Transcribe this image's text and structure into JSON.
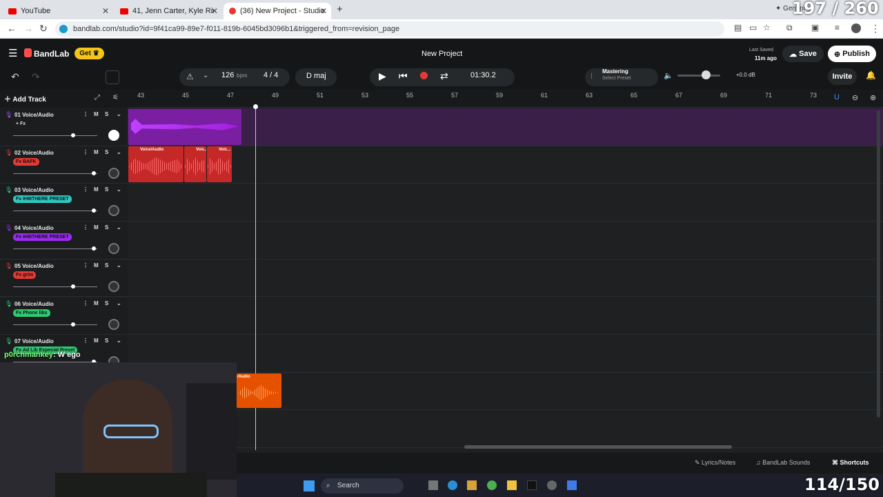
{
  "browser": {
    "tabs": [
      {
        "label": "YouTube"
      },
      {
        "label": "41, Jenn Carter, Kyle Richh, Tata"
      },
      {
        "label": "(36) New Project - Studio"
      }
    ],
    "new_tab": "+",
    "url": "bandlab.com/studio?id=9f41ca99-89e7-f011-819b-6045bd3096b1&triggered_from=revision_page",
    "right_badge": "Gemini"
  },
  "app": {
    "brand": "BandLab",
    "get_label": "Get",
    "project_title": "New Project",
    "last_saved_label": "Last Saved",
    "last_saved_time": "11m ago",
    "save_label": "Save",
    "publish_label": "Publish"
  },
  "toolbar": {
    "bpm_value": "126",
    "bpm_unit": "bpm",
    "time_sig": "4 / 4",
    "key": "D maj",
    "time": "01:30.2",
    "mastering_label": "Mastering",
    "mastering_preset": "Select Preset",
    "volume_db": "+0.0 dB",
    "invite_label": "Invite"
  },
  "tracks_header": {
    "add_track_label": "Add Track"
  },
  "ruler": [
    "43",
    "45",
    "47",
    "49",
    "51",
    "53",
    "55",
    "57",
    "59",
    "61",
    "63",
    "65",
    "67",
    "69",
    "71",
    "73"
  ],
  "tracks": [
    {
      "name": "01  Voice/Audio",
      "fx": "+ Fx",
      "fx_color": "none",
      "mic_color": "#b04cff",
      "m": "M",
      "s": "S",
      "volume": 0.7
    },
    {
      "name": "02  Voice/Audio",
      "fx": "Fx BAFK",
      "fx_color": "#e53935",
      "mic_color": "#e53935",
      "m": "M",
      "s": "S",
      "volume": 0.95
    },
    {
      "name": "03  Voice/Audio",
      "fx": "Fx IH8ITHERE PRESET",
      "fx_color": "#2ec9c2",
      "mic_color": "#2ec98a",
      "m": "M",
      "s": "S",
      "volume": 0.95
    },
    {
      "name": "04  Voice/Audio",
      "fx": "Fx IH8ITHERE PRESET",
      "fx_color": "#9b2cf0",
      "mic_color": "#9b2cf0",
      "m": "M",
      "s": "S",
      "volume": 0.95
    },
    {
      "name": "05  Voice/Audio",
      "fx": "Fx grim",
      "fx_color": "#e53935",
      "mic_color": "#e53935",
      "m": "M",
      "s": "S",
      "volume": 0.7
    },
    {
      "name": "06  Voice/Audio",
      "fx": "Fx Phone libs",
      "fx_color": "#2ecc71",
      "mic_color": "#2ecc71",
      "m": "M",
      "s": "S",
      "volume": 0.7
    },
    {
      "name": "07  Voice/Audio",
      "fx": "Fx Ad Lib Especial Preset",
      "fx_color": "#2ecc71",
      "mic_color": "#2ecc71",
      "m": "M",
      "s": "S",
      "volume": 0.95
    }
  ],
  "clips": {
    "track2": [
      "Voice/Audio",
      "Voic...",
      "Voic..."
    ],
    "orange": "/Audio"
  },
  "chat": {
    "user": "p0rchmankey",
    "message": ": W ego"
  },
  "bottom": {
    "lyrics_label": "Lyrics/Notes",
    "sounds_label": "BandLab Sounds",
    "shortcuts_label": "Shortcuts"
  },
  "taskbar": {
    "search_label": "Search"
  },
  "overlays": {
    "top_counter": "197 / 260",
    "bottom_counter": "114/150"
  }
}
